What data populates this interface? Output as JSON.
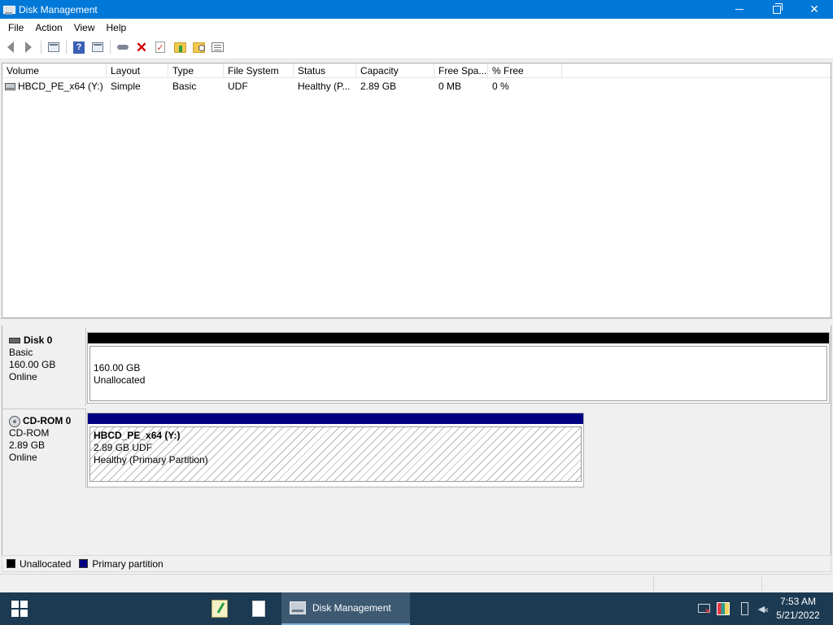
{
  "window": {
    "title": "Disk Management"
  },
  "menu": [
    "File",
    "Action",
    "View",
    "Help"
  ],
  "toolbar": {
    "icons": [
      "back-icon",
      "forward-icon",
      "show-hide-console-tree-icon",
      "help-icon",
      "properties-icon",
      "connect-disk-icon",
      "delete-icon",
      "check-icon",
      "open-folder-icon",
      "explore-icon",
      "details-list-icon"
    ]
  },
  "volume_list": {
    "columns": [
      "Volume",
      "Layout",
      "Type",
      "File System",
      "Status",
      "Capacity",
      "Free Spa...",
      "% Free"
    ],
    "rows": [
      {
        "volume": "HBCD_PE_x64 (Y:)",
        "layout": "Simple",
        "type": "Basic",
        "file_system": "UDF",
        "status": "Healthy (P...",
        "capacity": "2.89 GB",
        "free_space": "0 MB",
        "percent_free": "0 %"
      }
    ]
  },
  "disks": [
    {
      "name": "Disk 0",
      "type": "Basic",
      "size": "160.00 GB",
      "state": "Online",
      "partition": {
        "size": "160.00 GB",
        "label": "Unallocated"
      }
    },
    {
      "name": "CD-ROM 0",
      "type": "CD-ROM",
      "size": "2.89 GB",
      "state": "Online",
      "partition": {
        "name": "HBCD_PE_x64  (Y:)",
        "size_fs": "2.89 GB UDF",
        "status": "Healthy (Primary Partition)"
      }
    }
  ],
  "legend": [
    {
      "label": "Unallocated",
      "color": "#000000"
    },
    {
      "label": "Primary partition",
      "color": "#000080"
    }
  ],
  "taskbar": {
    "active_app": "Disk Management",
    "time": "7:53 AM",
    "date": "5/21/2022"
  },
  "colors": {
    "titlebar": "#0078d7",
    "taskbar": "#1c3a52",
    "unallocated": "#000000",
    "primary_partition": "#000080"
  }
}
